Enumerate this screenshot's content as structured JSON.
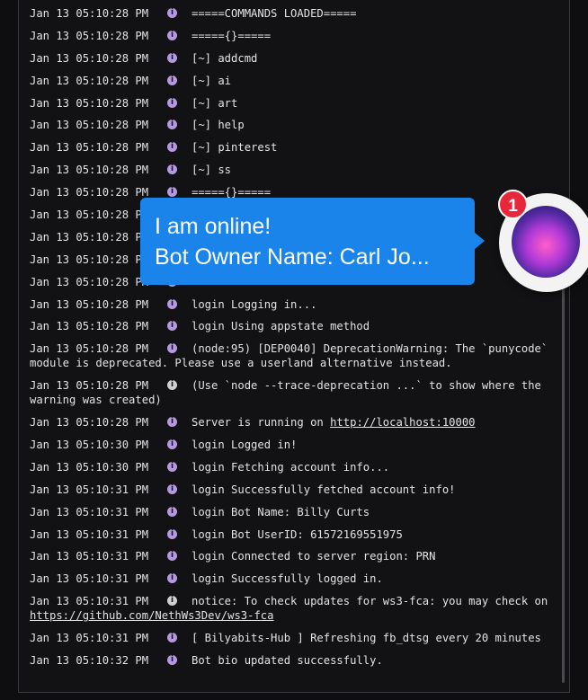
{
  "log_lines": [
    {
      "ts": "Jan 13 05:10:28 PM",
      "msg": "=====COMMANDS LOADED=====",
      "icon": "info"
    },
    {
      "ts": "Jan 13 05:10:28 PM",
      "msg": "====={}=====",
      "icon": "info"
    },
    {
      "ts": "Jan 13 05:10:28 PM",
      "msg": "[~] addcmd",
      "icon": "info"
    },
    {
      "ts": "Jan 13 05:10:28 PM",
      "msg": "[~] ai",
      "icon": "info"
    },
    {
      "ts": "Jan 13 05:10:28 PM",
      "msg": "[~] art",
      "icon": "info"
    },
    {
      "ts": "Jan 13 05:10:28 PM",
      "msg": "[~] help",
      "icon": "info"
    },
    {
      "ts": "Jan 13 05:10:28 PM",
      "msg": "[~] pinterest",
      "icon": "info"
    },
    {
      "ts": "Jan 13 05:10:28 PM",
      "msg": "[~] ss",
      "icon": "info"
    },
    {
      "ts": "Jan 13 05:10:28 PM",
      "msg": "====={}=====",
      "icon": "info"
    },
    {
      "ts": "Jan 13 05:10:28 PM",
      "msg": "",
      "icon": "info"
    },
    {
      "ts": "Jan 13 05:10:28 PM",
      "msg": "",
      "icon": "info"
    },
    {
      "ts": "Jan 13 05:10:28 PM",
      "msg": "",
      "icon": "info"
    },
    {
      "ts": "Jan 13 05:10:28 PM",
      "msg": "",
      "icon": "info"
    },
    {
      "ts": "Jan 13 05:10:28 PM",
      "msg": "login Logging in...",
      "icon": "info"
    },
    {
      "ts": "Jan 13 05:10:28 PM",
      "msg": "login Using appstate method",
      "icon": "info"
    }
  ],
  "dep_warning": {
    "ts": "Jan 13 05:10:28 PM",
    "msg": "(node:95) [DEP0040] DeprecationWarning: The `punycode`",
    "cont": "module is deprecated. Please use a userland alternative instead."
  },
  "trace_line": {
    "ts": "Jan 13 05:10:28 PM",
    "msg": "(Use `node --trace-deprecation ...` to show where the",
    "cont": "warning was created)"
  },
  "server_line": {
    "ts": "Jan 13 05:10:28 PM",
    "msg": "Server is running on ",
    "link": "http://localhost:10000"
  },
  "log_lines2": [
    {
      "ts": "Jan 13 05:10:30 PM",
      "msg": "login Logged in!"
    },
    {
      "ts": "Jan 13 05:10:30 PM",
      "msg": "login Fetching account info..."
    },
    {
      "ts": "Jan 13 05:10:31 PM",
      "msg": "login Successfully fetched account info!"
    },
    {
      "ts": "Jan 13 05:10:31 PM",
      "msg": "login Bot Name: Billy Curts"
    },
    {
      "ts": "Jan 13 05:10:31 PM",
      "msg": "login Bot UserID: 61572169551975"
    },
    {
      "ts": "Jan 13 05:10:31 PM",
      "msg": "login Connected to server region: PRN"
    },
    {
      "ts": "Jan 13 05:10:31 PM",
      "msg": "login Successfully logged in."
    }
  ],
  "notice_line": {
    "ts": "Jan 13 05:10:31 PM",
    "msg": "notice: To check updates for ws3-fca: you may check on",
    "link": "https://github.com/NethWs3Dev/ws3-fca"
  },
  "log_lines3": [
    {
      "ts": "Jan 13 05:10:31 PM",
      "msg": "[ Bilyabits-Hub ] Refreshing fb_dtsg every 20 minutes"
    },
    {
      "ts": "Jan 13 05:10:32 PM",
      "msg": "Bot bio updated successfully."
    }
  ],
  "notification": {
    "line1": "I am online!",
    "line2": "Bot Owner Name: Carl Jo...",
    "badge_count": "1"
  },
  "colors": {
    "info_icon": "#b49be0",
    "bubble": "#1a84ea",
    "badge": "#e8283a"
  }
}
